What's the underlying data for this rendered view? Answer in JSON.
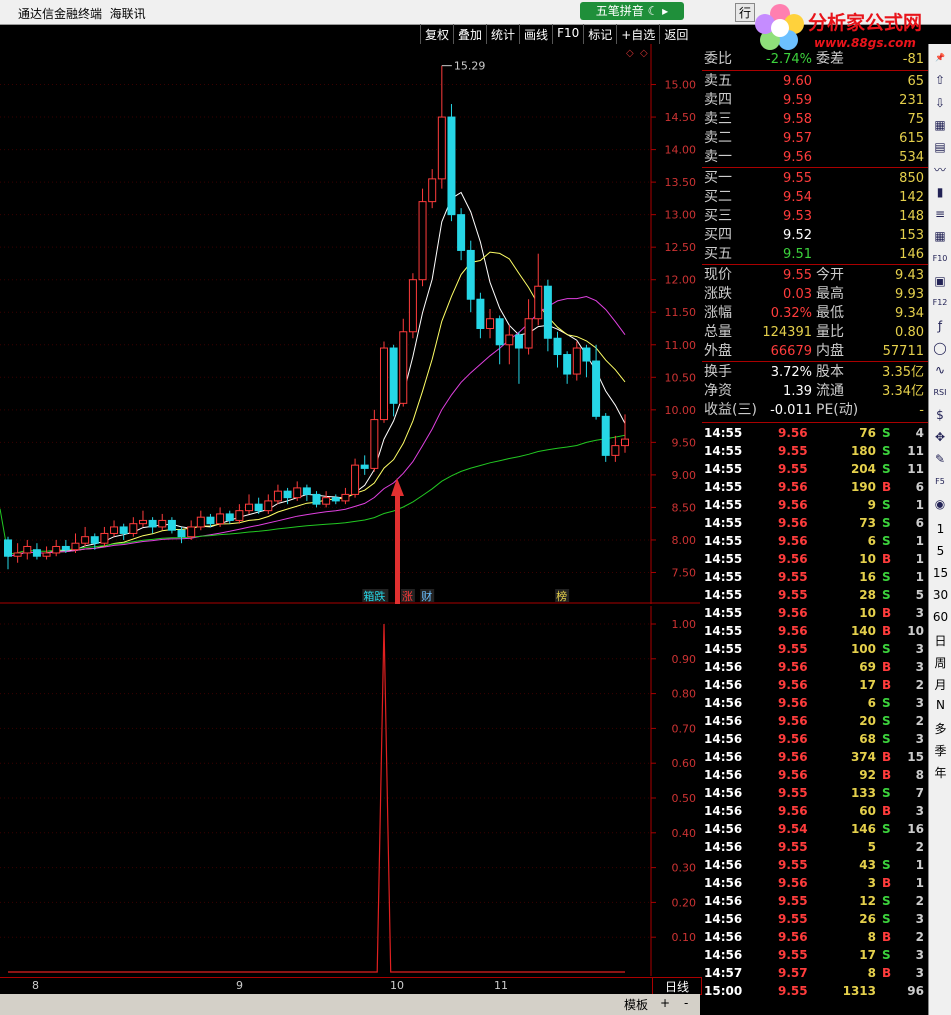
{
  "titlebar": {
    "app_name": "通达信金融终端",
    "sub_name": "海联讯",
    "pinyin_button": "五笔拼音",
    "row_btn": "行"
  },
  "logo": {
    "name": "分析家公式网",
    "url": "www.88gs.com"
  },
  "toolbar": [
    "复权",
    "叠加",
    "统计",
    "画线",
    "F10",
    "标记",
    "+自选",
    "返回"
  ],
  "main_chart": {
    "high_label": "15.29",
    "y_ticks": [
      "15.00",
      "14.50",
      "14.00",
      "13.50",
      "13.00",
      "12.50",
      "12.00",
      "11.50",
      "11.00",
      "10.50",
      "10.00",
      "9.50",
      "9.00",
      "8.50",
      "8.00",
      "7.50"
    ],
    "markers": [
      {
        "label": "箱跌"
      },
      {
        "label": "涨"
      },
      {
        "label": "财"
      },
      {
        "label": "榜"
      }
    ]
  },
  "sub_chart": {
    "y_ticks": [
      "1.00",
      "0.90",
      "0.80",
      "0.70",
      "0.60",
      "0.50",
      "0.40",
      "0.30",
      "0.20",
      "0.10"
    ]
  },
  "chart_data": [
    {
      "type": "candlestick",
      "title": "",
      "ylim": [
        7.2,
        15.5
      ],
      "candles": [
        [
          8.0,
          7.75,
          8.05,
          7.55
        ],
        [
          7.75,
          7.8,
          7.95,
          7.65
        ],
        [
          7.8,
          7.9,
          8.0,
          7.7
        ],
        [
          7.85,
          7.75,
          7.95,
          7.7
        ],
        [
          7.75,
          7.8,
          7.9,
          7.7
        ],
        [
          7.8,
          7.9,
          8.0,
          7.75
        ],
        [
          7.9,
          7.85,
          8.0,
          7.8
        ],
        [
          7.85,
          7.95,
          8.1,
          7.8
        ],
        [
          7.95,
          8.05,
          8.2,
          7.9
        ],
        [
          8.05,
          7.95,
          8.1,
          7.85
        ],
        [
          7.95,
          8.1,
          8.2,
          7.9
        ],
        [
          8.1,
          8.2,
          8.3,
          8.05
        ],
        [
          8.2,
          8.1,
          8.25,
          8.0
        ],
        [
          8.1,
          8.25,
          8.35,
          8.05
        ],
        [
          8.25,
          8.3,
          8.45,
          8.2
        ],
        [
          8.3,
          8.2,
          8.35,
          8.1
        ],
        [
          8.2,
          8.3,
          8.4,
          8.15
        ],
        [
          8.3,
          8.15,
          8.35,
          8.1
        ],
        [
          8.15,
          8.05,
          8.2,
          7.95
        ],
        [
          8.05,
          8.2,
          8.3,
          8.0
        ],
        [
          8.2,
          8.35,
          8.45,
          8.15
        ],
        [
          8.35,
          8.25,
          8.4,
          8.2
        ],
        [
          8.25,
          8.4,
          8.5,
          8.2
        ],
        [
          8.4,
          8.3,
          8.45,
          8.25
        ],
        [
          8.3,
          8.45,
          8.55,
          8.25
        ],
        [
          8.45,
          8.55,
          8.7,
          8.4
        ],
        [
          8.55,
          8.45,
          8.65,
          8.4
        ],
        [
          8.45,
          8.6,
          8.7,
          8.4
        ],
        [
          8.6,
          8.75,
          8.85,
          8.55
        ],
        [
          8.75,
          8.65,
          8.8,
          8.55
        ],
        [
          8.65,
          8.8,
          8.9,
          8.6
        ],
        [
          8.8,
          8.7,
          8.85,
          8.6
        ],
        [
          8.7,
          8.55,
          8.75,
          8.5
        ],
        [
          8.55,
          8.65,
          8.75,
          8.5
        ],
        [
          8.65,
          8.6,
          8.7,
          8.55
        ],
        [
          8.6,
          8.7,
          8.8,
          8.55
        ],
        [
          8.7,
          9.15,
          9.25,
          8.65
        ],
        [
          9.15,
          9.1,
          9.3,
          9.0
        ],
        [
          9.1,
          9.85,
          10.0,
          9.05
        ],
        [
          9.85,
          10.95,
          11.05,
          9.8
        ],
        [
          10.95,
          10.1,
          11.0,
          9.9
        ],
        [
          10.1,
          11.2,
          11.4,
          10.05
        ],
        [
          11.2,
          12.0,
          12.1,
          11.1
        ],
        [
          12.0,
          13.2,
          13.4,
          11.9
        ],
        [
          13.2,
          13.55,
          13.7,
          13.1
        ],
        [
          13.55,
          14.5,
          15.29,
          13.4
        ],
        [
          14.5,
          13.0,
          14.7,
          12.9
        ],
        [
          13.0,
          12.45,
          13.1,
          12.3
        ],
        [
          12.45,
          11.7,
          12.6,
          11.5
        ],
        [
          11.7,
          11.25,
          11.8,
          11.1
        ],
        [
          11.25,
          11.4,
          11.55,
          11.1
        ],
        [
          11.4,
          11.0,
          11.45,
          10.7
        ],
        [
          11.0,
          11.15,
          11.3,
          10.7
        ],
        [
          11.15,
          10.95,
          11.2,
          10.4
        ],
        [
          10.95,
          11.4,
          11.7,
          10.85
        ],
        [
          11.4,
          11.9,
          12.4,
          11.3
        ],
        [
          11.9,
          11.1,
          12.0,
          10.9
        ],
        [
          11.1,
          10.85,
          11.2,
          10.65
        ],
        [
          10.85,
          10.55,
          10.9,
          10.4
        ],
        [
          10.55,
          10.95,
          11.05,
          10.45
        ],
        [
          10.95,
          10.75,
          11.0,
          10.5
        ],
        [
          10.75,
          9.9,
          11.0,
          9.85
        ],
        [
          9.9,
          9.3,
          9.95,
          9.2
        ],
        [
          9.3,
          9.45,
          9.6,
          9.2
        ],
        [
          9.45,
          9.55,
          9.93,
          9.34
        ]
      ],
      "ma_colors": [
        "#ffffff",
        "#ffff66",
        "#e040e0",
        "#22c822"
      ]
    },
    {
      "type": "line",
      "title": "",
      "ylim": [
        0,
        1.0
      ],
      "series": [
        {
          "values": [
            0,
            0,
            0,
            0,
            0,
            0,
            0,
            0,
            0,
            0,
            0,
            0,
            0,
            0,
            0,
            0,
            0,
            0,
            0,
            0,
            0,
            0,
            0,
            0,
            0,
            0,
            0,
            0,
            0,
            0,
            0,
            0,
            0,
            0,
            0,
            0,
            0,
            0,
            0,
            1.0,
            0,
            0,
            0,
            0,
            0,
            0,
            0,
            0,
            0,
            0,
            0,
            0,
            0,
            0,
            0,
            0,
            0,
            0,
            0,
            0,
            0,
            0,
            0,
            0,
            0
          ]
        }
      ],
      "color": "#e02020"
    }
  ],
  "x_axis": {
    "labels": [
      "8",
      "9",
      "10",
      "11"
    ],
    "period": "日线"
  },
  "bottom_bar": {
    "template": "模板",
    "plus": "+",
    "minus": "-"
  },
  "quote": {
    "wei_bi": {
      "label": "委比",
      "value": "-2.74%",
      "label2": "委差",
      "value2": "-81"
    },
    "sell": [
      {
        "label": "卖五",
        "price": "9.60",
        "vol": "65"
      },
      {
        "label": "卖四",
        "price": "9.59",
        "vol": "231"
      },
      {
        "label": "卖三",
        "price": "9.58",
        "vol": "75"
      },
      {
        "label": "卖二",
        "price": "9.57",
        "vol": "615"
      },
      {
        "label": "卖一",
        "price": "9.56",
        "vol": "534"
      }
    ],
    "buy": [
      {
        "label": "买一",
        "price": "9.55",
        "vol": "850"
      },
      {
        "label": "买二",
        "price": "9.54",
        "vol": "142"
      },
      {
        "label": "买三",
        "price": "9.53",
        "vol": "148"
      },
      {
        "label": "买四",
        "price": "9.52",
        "vol": "153"
      },
      {
        "label": "买五",
        "price": "9.51",
        "vol": "146"
      }
    ],
    "stats": [
      {
        "l1": "现价",
        "v1": "9.55",
        "l2": "今开",
        "v2": "9.43"
      },
      {
        "l1": "涨跌",
        "v1": "0.03",
        "l2": "最高",
        "v2": "9.93"
      },
      {
        "l1": "涨幅",
        "v1": "0.32%",
        "l2": "最低",
        "v2": "9.34"
      },
      {
        "l1": "总量",
        "v1": "124391",
        "l2": "量比",
        "v2": "0.80"
      },
      {
        "l1": "外盘",
        "v1": "66679",
        "l2": "内盘",
        "v2": "57711"
      }
    ],
    "stats2": [
      {
        "l1": "换手",
        "v1": "3.72%",
        "l2": "股本",
        "v2": "3.35亿"
      },
      {
        "l1": "净资",
        "v1": "1.39",
        "l2": "流通",
        "v2": "3.34亿"
      },
      {
        "l1": "收益(三)",
        "v1": "-0.011",
        "l2": "PE(动)",
        "v2": "-"
      }
    ]
  },
  "ticks": [
    {
      "t": "14:55",
      "p": "9.56",
      "n": "76",
      "f": "S",
      "c": "4"
    },
    {
      "t": "14:55",
      "p": "9.55",
      "n": "180",
      "f": "S",
      "c": "11"
    },
    {
      "t": "14:55",
      "p": "9.55",
      "n": "204",
      "f": "S",
      "c": "11"
    },
    {
      "t": "14:55",
      "p": "9.56",
      "n": "190",
      "f": "B",
      "c": "6"
    },
    {
      "t": "14:55",
      "p": "9.56",
      "n": "9",
      "f": "S",
      "c": "1"
    },
    {
      "t": "14:55",
      "p": "9.56",
      "n": "73",
      "f": "S",
      "c": "6"
    },
    {
      "t": "14:55",
      "p": "9.56",
      "n": "6",
      "f": "S",
      "c": "1"
    },
    {
      "t": "14:55",
      "p": "9.56",
      "n": "10",
      "f": "B",
      "c": "1"
    },
    {
      "t": "14:55",
      "p": "9.55",
      "n": "16",
      "f": "S",
      "c": "1"
    },
    {
      "t": "14:55",
      "p": "9.55",
      "n": "28",
      "f": "S",
      "c": "5"
    },
    {
      "t": "14:55",
      "p": "9.56",
      "n": "10",
      "f": "B",
      "c": "3"
    },
    {
      "t": "14:55",
      "p": "9.56",
      "n": "140",
      "f": "B",
      "c": "10"
    },
    {
      "t": "14:55",
      "p": "9.55",
      "n": "100",
      "f": "S",
      "c": "3"
    },
    {
      "t": "14:56",
      "p": "9.56",
      "n": "69",
      "f": "B",
      "c": "3"
    },
    {
      "t": "14:56",
      "p": "9.56",
      "n": "17",
      "f": "B",
      "c": "2"
    },
    {
      "t": "14:56",
      "p": "9.56",
      "n": "6",
      "f": "S",
      "c": "3"
    },
    {
      "t": "14:56",
      "p": "9.56",
      "n": "20",
      "f": "S",
      "c": "2"
    },
    {
      "t": "14:56",
      "p": "9.56",
      "n": "68",
      "f": "S",
      "c": "3"
    },
    {
      "t": "14:56",
      "p": "9.56",
      "n": "374",
      "f": "B",
      "c": "15"
    },
    {
      "t": "14:56",
      "p": "9.56",
      "n": "92",
      "f": "B",
      "c": "8"
    },
    {
      "t": "14:56",
      "p": "9.55",
      "n": "133",
      "f": "S",
      "c": "7"
    },
    {
      "t": "14:56",
      "p": "9.56",
      "n": "60",
      "f": "B",
      "c": "3"
    },
    {
      "t": "14:56",
      "p": "9.54",
      "n": "146",
      "f": "S",
      "c": "16"
    },
    {
      "t": "14:56",
      "p": "9.55",
      "n": "5",
      "f": "",
      "c": "2"
    },
    {
      "t": "14:56",
      "p": "9.55",
      "n": "43",
      "f": "S",
      "c": "1"
    },
    {
      "t": "14:56",
      "p": "9.56",
      "n": "3",
      "f": "B",
      "c": "1"
    },
    {
      "t": "14:56",
      "p": "9.55",
      "n": "12",
      "f": "S",
      "c": "2"
    },
    {
      "t": "14:56",
      "p": "9.55",
      "n": "26",
      "f": "S",
      "c": "3"
    },
    {
      "t": "14:56",
      "p": "9.56",
      "n": "8",
      "f": "B",
      "c": "2"
    },
    {
      "t": "14:56",
      "p": "9.55",
      "n": "17",
      "f": "S",
      "c": "3"
    },
    {
      "t": "14:57",
      "p": "9.57",
      "n": "8",
      "f": "B",
      "c": "3"
    },
    {
      "t": "15:00",
      "p": "9.55",
      "n": "1313",
      "f": "",
      "c": "96"
    }
  ],
  "sidebar": {
    "icons": [
      "pin-icon",
      "up-arrow-icon",
      "down-arrow-icon",
      "board-icon",
      "quote-icon",
      "trend-icon",
      "kline-icon",
      "list-icon",
      "table-icon",
      "f10-icon",
      "news-icon",
      "f12-icon",
      "formula-icon",
      "circle-icon",
      "chart-icon",
      "rsi-icon",
      "dollar-icon",
      "move-icon",
      "pencil-icon",
      "f5-icon",
      "ring-icon"
    ],
    "icon_text": {
      "rsi": "RSI",
      "f10": "F10",
      "f12": "F12",
      "f5": "F5",
      "fx": "f(x)"
    },
    "periods": [
      "1",
      "5",
      "15",
      "30",
      "60",
      "日",
      "周",
      "月",
      "N",
      "多",
      "季",
      "年"
    ]
  }
}
